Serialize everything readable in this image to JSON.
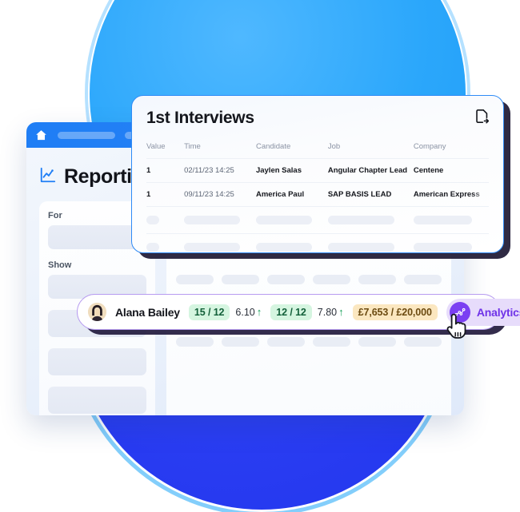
{
  "background": {
    "top_circle_color": "#2ba7fb",
    "bottom_circle_color": "#2a3df2",
    "ring_color": "#5abefa"
  },
  "app_window": {
    "topbar": {
      "home_icon": "home-icon",
      "placeholders": [
        "",
        "",
        ""
      ],
      "accent_color": "#1f7ef5"
    },
    "page_title": "Reporting",
    "page_title_icon": "line-chart-icon",
    "form": {
      "fields": [
        {
          "label": "For",
          "value": ""
        },
        {
          "label": "Show",
          "value": ""
        }
      ],
      "extra_skeletons": 3
    },
    "results_skeleton": {
      "rows": 5,
      "columns": 6
    }
  },
  "interviews_card": {
    "title": "1st Interviews",
    "export_icon": "file-export-icon",
    "border_color": "#2f8bf6",
    "columns": [
      "Value",
      "Time",
      "Candidate",
      "Job",
      "Company"
    ],
    "rows": [
      {
        "value": "1",
        "time": "02/11/23 14:25",
        "candidate": "Jaylen Salas",
        "job": "Angular Chapter Lead",
        "company": "Centene"
      },
      {
        "value": "1",
        "time": "09/11/23 14:25",
        "candidate": "America Paul",
        "job": "SAP BASIS LEAD",
        "company": "American Express"
      }
    ],
    "skeleton_rows": 2
  },
  "alana_bar": {
    "avatar_icon": "user-avatar",
    "name": "Alana Bailey",
    "border_color": "#b79cf0",
    "metrics": [
      {
        "chip": "15 / 12",
        "chip_color": "#d5f5e0",
        "value": "6.10",
        "trend": "↑"
      },
      {
        "chip": "12 / 12",
        "chip_color": "#d5f5e0",
        "value": "7.80",
        "trend": "↑"
      }
    ],
    "revenue_chip": {
      "text": "£7,653 / £20,000",
      "chip_color": "#fbe7c0"
    },
    "analytics_button": {
      "label": "Analytics",
      "icon": "analytics-network-icon",
      "background": "#e7dcfb",
      "icon_background": "#7b3ff2",
      "text_color": "#6f33e8"
    },
    "cursor": "hand-pointer-cursor"
  }
}
